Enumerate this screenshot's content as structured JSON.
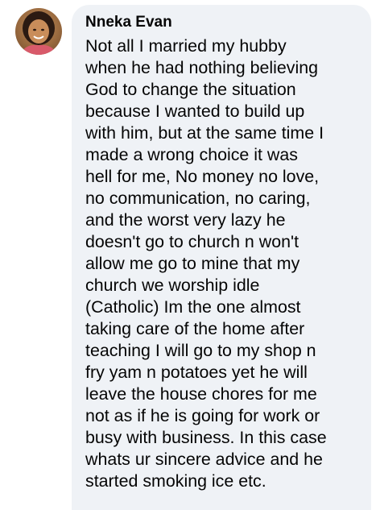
{
  "comment": {
    "author_name": "Nneka Evan",
    "avatar_icon": "profile-photo",
    "text": "Not all I married my hubby\nwhen he had nothing believing\nGod to change the situation\nbecause I wanted to build up\nwith him, but at the same time I\nmade a wrong choice it was\nhell for me, No money no love,\nno communication, no caring,\nand the worst very lazy he\ndoesn't go to  church n won't\nallow me go to mine that my\nchurch we worship idle\n(Catholic) Im the one almost\ntaking care of the home after\nteaching I will go to my shop n\nfry yam n potatoes yet he will\nleave the house chores for me\nnot as if he is going for work or\nbusy with business. In this case\nwhats ur sincere advice and he\nstarted smoking ice etc."
  },
  "colors": {
    "bubble_background": "#eff2f6",
    "text": "#050505"
  }
}
